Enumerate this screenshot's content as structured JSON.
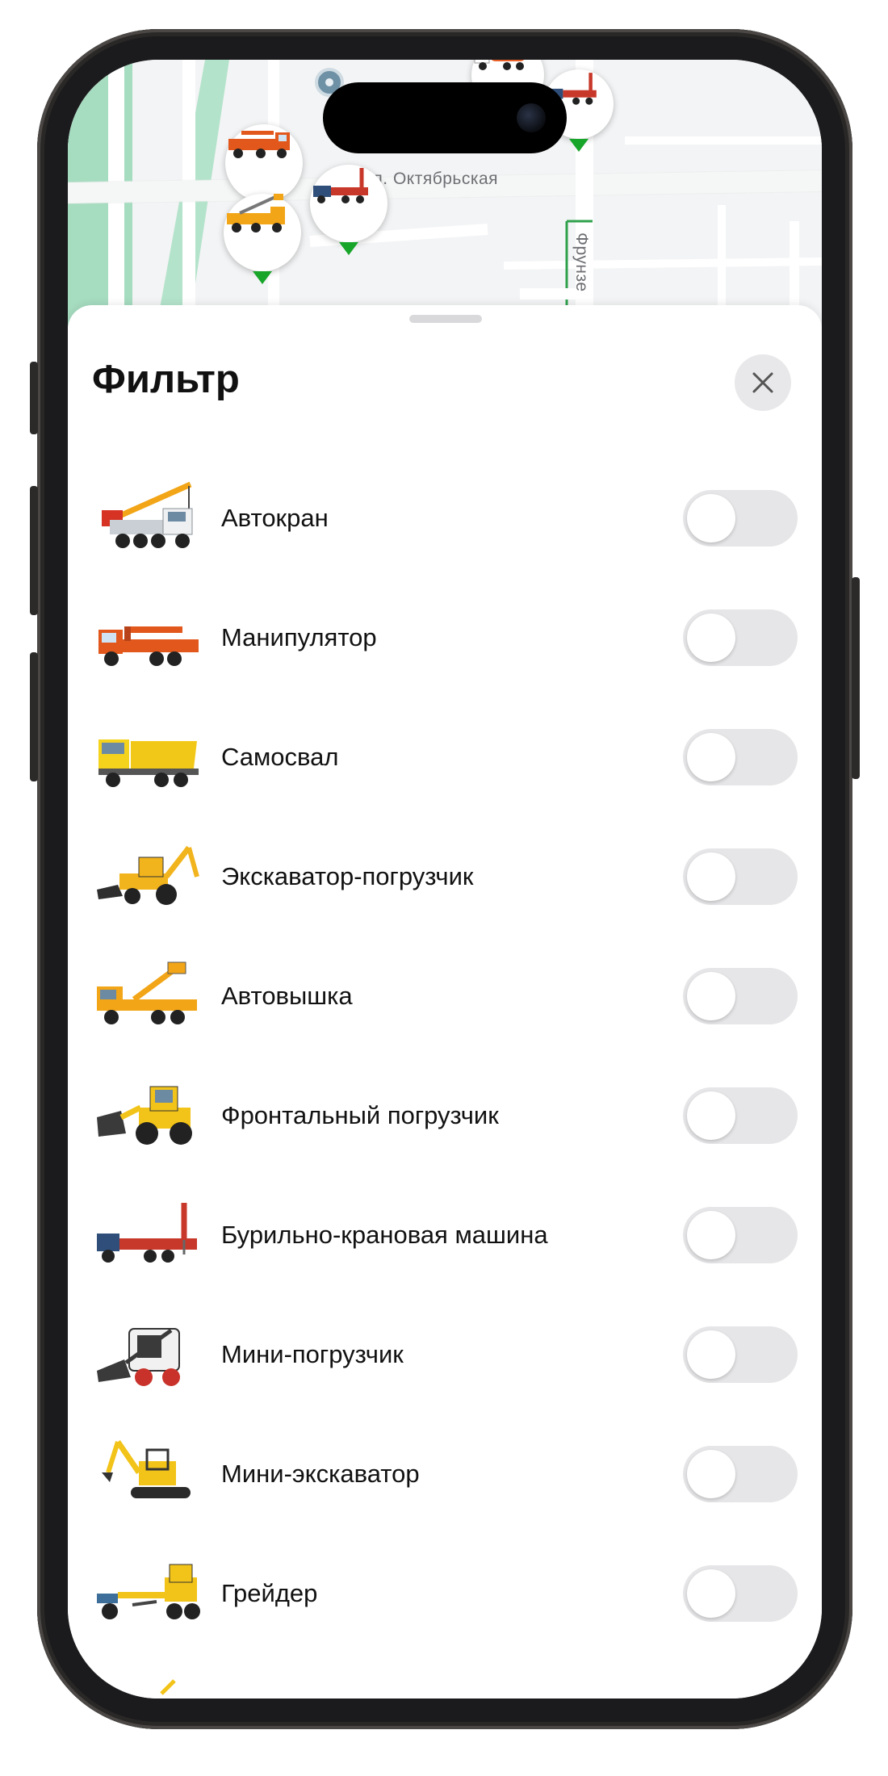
{
  "map": {
    "street_ulitsa": "ул. Октябрьская",
    "street_frunze": "Фрунзе",
    "colors": {
      "park": "#a6dcc0",
      "road": "#ffffff",
      "background": "#f3f4f5",
      "marker_tip": "#17a52a"
    }
  },
  "sheet": {
    "title": "Фильтр",
    "close_icon": "close-icon"
  },
  "filters": {
    "items": [
      {
        "label": "Автокран",
        "icon": "crane-truck-icon",
        "enabled": false
      },
      {
        "label": "Манипулятор",
        "icon": "manipulator-truck-icon",
        "enabled": false
      },
      {
        "label": "Самосвал",
        "icon": "dump-truck-icon",
        "enabled": false
      },
      {
        "label": "Экскаватор-погрузчик",
        "icon": "backhoe-loader-icon",
        "enabled": false
      },
      {
        "label": "Автовышка",
        "icon": "aerial-platform-icon",
        "enabled": false
      },
      {
        "label": "Фронтальный погрузчик",
        "icon": "wheel-loader-icon",
        "enabled": false
      },
      {
        "label": "Бурильно-крановая машина",
        "icon": "drilling-crane-icon",
        "enabled": false
      },
      {
        "label": "Мини-погрузчик",
        "icon": "skid-steer-icon",
        "enabled": false
      },
      {
        "label": "Мини-экскаватор",
        "icon": "mini-excavator-icon",
        "enabled": false
      },
      {
        "label": "Грейдер",
        "icon": "grader-icon",
        "enabled": false
      }
    ]
  }
}
